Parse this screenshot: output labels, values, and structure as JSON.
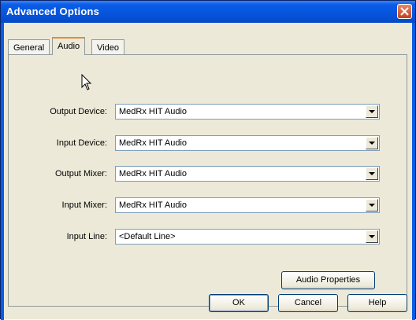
{
  "window": {
    "title": "Advanced Options"
  },
  "tabs": [
    {
      "label": "General",
      "active": false
    },
    {
      "label": "Audio",
      "active": true
    },
    {
      "label": "Video",
      "active": false
    }
  ],
  "fields": [
    {
      "label": "Output Device:",
      "value": "MedRx HIT Audio"
    },
    {
      "label": "Input Device:",
      "value": "MedRx HIT Audio"
    },
    {
      "label": "Output Mixer:",
      "value": "MedRx HIT Audio"
    },
    {
      "label": "Input Mixer:",
      "value": "MedRx HIT Audio"
    },
    {
      "label": "Input Line:",
      "value": "<Default Line>"
    }
  ],
  "buttons": {
    "audio_properties": "Audio Properties",
    "ok": "OK",
    "cancel": "Cancel",
    "help": "Help"
  },
  "icons": {
    "close": "close-icon",
    "dropdown": "chevron-down-icon",
    "cursor": "mouse-pointer-icon"
  },
  "colors": {
    "titlebar": "#0a5ce6",
    "face": "#ece9d8",
    "close": "#c2421c",
    "active_tab_accent": "#e68b2c"
  }
}
